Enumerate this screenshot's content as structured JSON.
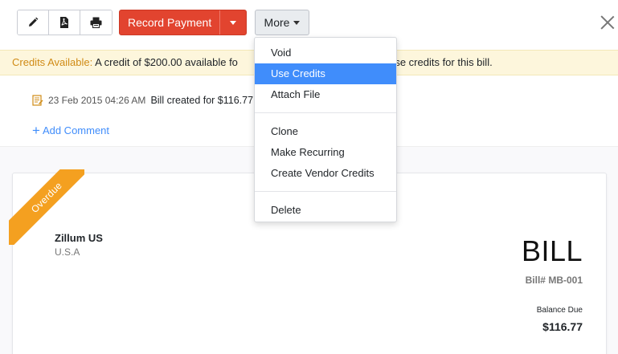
{
  "toolbar": {
    "edit_icon": "pencil-icon",
    "pdf_icon": "pdf-icon",
    "print_icon": "printer-icon",
    "record_payment_label": "Record Payment",
    "more_label": "More"
  },
  "banner": {
    "label": "Credits Available:",
    "text": " A credit of $200.00 available fo",
    "text_tail": "se these credits for this bill."
  },
  "activity": {
    "timestamp": "23 Feb 2015 04:26 AM",
    "event": "Bill created for $116.77",
    "add_comment": "Add Comment"
  },
  "bill": {
    "status_ribbon": "Overdue",
    "vendor_name": "Zillum US",
    "vendor_country": "U.S.A",
    "title": "BILL",
    "number": "Bill# MB-001",
    "balance_label": "Balance Due",
    "balance_value": "$116.77"
  },
  "more_menu": {
    "items": [
      "Void",
      "Use Credits",
      "Attach File"
    ],
    "items2": [
      "Clone",
      "Make Recurring",
      "Create Vendor Credits"
    ],
    "items3": [
      "Delete"
    ],
    "active": "Use Credits"
  },
  "colors": {
    "record_payment": "#e2442f",
    "accent_blue": "#408dfb",
    "ribbon": "#f4a020",
    "banner_bg": "#fdf6dc"
  }
}
